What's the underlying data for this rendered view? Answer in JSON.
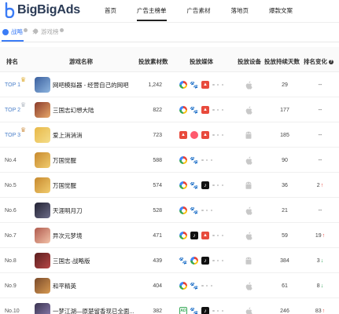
{
  "brand": {
    "name": "BigBigAds"
  },
  "nav": [
    {
      "label": "首页",
      "active": false
    },
    {
      "label": "广告主榜单",
      "active": true
    },
    {
      "label": "广告素材",
      "active": false
    },
    {
      "label": "落地页",
      "active": false
    },
    {
      "label": "爆款文案",
      "active": false
    }
  ],
  "subtabs": [
    {
      "label": "战略",
      "active": true
    },
    {
      "label": "游戏榜",
      "active": false
    }
  ],
  "table": {
    "headers": {
      "rank": "排名",
      "game": "游戏名称",
      "count": "投放素材数",
      "media": "投放媒体",
      "device": "投放设备",
      "days": "投放持续天数",
      "change": "排名变化"
    },
    "rows": [
      {
        "rank": "TOP 1",
        "top": true,
        "crown": "gold",
        "name": "网吧模拟器 - 经营自己的网吧",
        "count": "1,242",
        "media": [
          "rainbow",
          "paw",
          "red"
        ],
        "device": "apple",
        "days": "29",
        "change": "--",
        "dir": "",
        "icon": [
          "#3a5f9e",
          "#8fb6e0"
        ]
      },
      {
        "rank": "TOP 2",
        "top": true,
        "crown": "silver",
        "name": "三国志幻想大陆",
        "count": "822",
        "media": [
          "rainbow",
          "paw",
          "red"
        ],
        "device": "apple",
        "days": "177",
        "change": "--",
        "dir": "",
        "icon": [
          "#8a3b2b",
          "#e8a86a"
        ]
      },
      {
        "rank": "TOP 3",
        "top": true,
        "crown": "bronze",
        "name": "爱上消消消",
        "count": "723",
        "media": [
          "red",
          "pink",
          "red"
        ],
        "device": "android",
        "days": "185",
        "change": "--",
        "dir": "",
        "icon": [
          "#e8b848",
          "#f4dd8a"
        ]
      },
      {
        "rank": "No.4",
        "top": false,
        "crown": "",
        "name": "万国觉醒",
        "count": "588",
        "media": [
          "rainbow",
          "paw"
        ],
        "device": "apple",
        "days": "90",
        "change": "--",
        "dir": "",
        "icon": [
          "#c7892e",
          "#f1cc6e"
        ]
      },
      {
        "rank": "No.5",
        "top": false,
        "crown": "",
        "name": "万国觉醒",
        "count": "574",
        "media": [
          "rainbow",
          "paw",
          "tiktok"
        ],
        "device": "android",
        "days": "36",
        "change": "2",
        "dir": "up",
        "icon": [
          "#c7892e",
          "#f1cc6e"
        ]
      },
      {
        "rank": "No.6",
        "top": false,
        "crown": "",
        "name": "天涯明月刀",
        "count": "528",
        "media": [
          "rainbow",
          "paw"
        ],
        "device": "apple",
        "days": "21",
        "change": "--",
        "dir": "",
        "icon": [
          "#222233",
          "#6c6c88"
        ]
      },
      {
        "rank": "No.7",
        "top": false,
        "crown": "",
        "name": "异次元梦境",
        "count": "471",
        "media": [
          "rainbow",
          "tiktok",
          "red"
        ],
        "device": "apple",
        "days": "59",
        "change": "19",
        "dir": "up",
        "icon": [
          "#b05a4e",
          "#f3c2a8"
        ]
      },
      {
        "rank": "No.8",
        "top": false,
        "crown": "",
        "name": "三国志·战略版",
        "count": "439",
        "media": [
          "paw",
          "rainbow",
          "tiktok"
        ],
        "device": "android",
        "days": "384",
        "change": "3",
        "dir": "down",
        "icon": [
          "#5a1e1e",
          "#b64646"
        ]
      },
      {
        "rank": "No.9",
        "top": false,
        "crown": "",
        "name": "和平精英",
        "count": "404",
        "media": [
          "rainbow",
          "paw"
        ],
        "device": "apple",
        "days": "61",
        "change": "8",
        "dir": "down",
        "icon": [
          "#7a4a2a",
          "#d79a52"
        ]
      },
      {
        "rank": "No.10",
        "top": false,
        "crown": "",
        "name": "一梦江湖—原楚留香现已全面...",
        "count": "382",
        "media": [
          "green",
          "paw",
          "tiktok"
        ],
        "device": "apple",
        "days": "246",
        "change": "83",
        "dir": "up",
        "icon": [
          "#3a3350",
          "#8d7fb0"
        ]
      }
    ]
  },
  "colors": {
    "accent": "#3b7cf6",
    "up": "#e8453c",
    "down": "#2fa35a"
  }
}
